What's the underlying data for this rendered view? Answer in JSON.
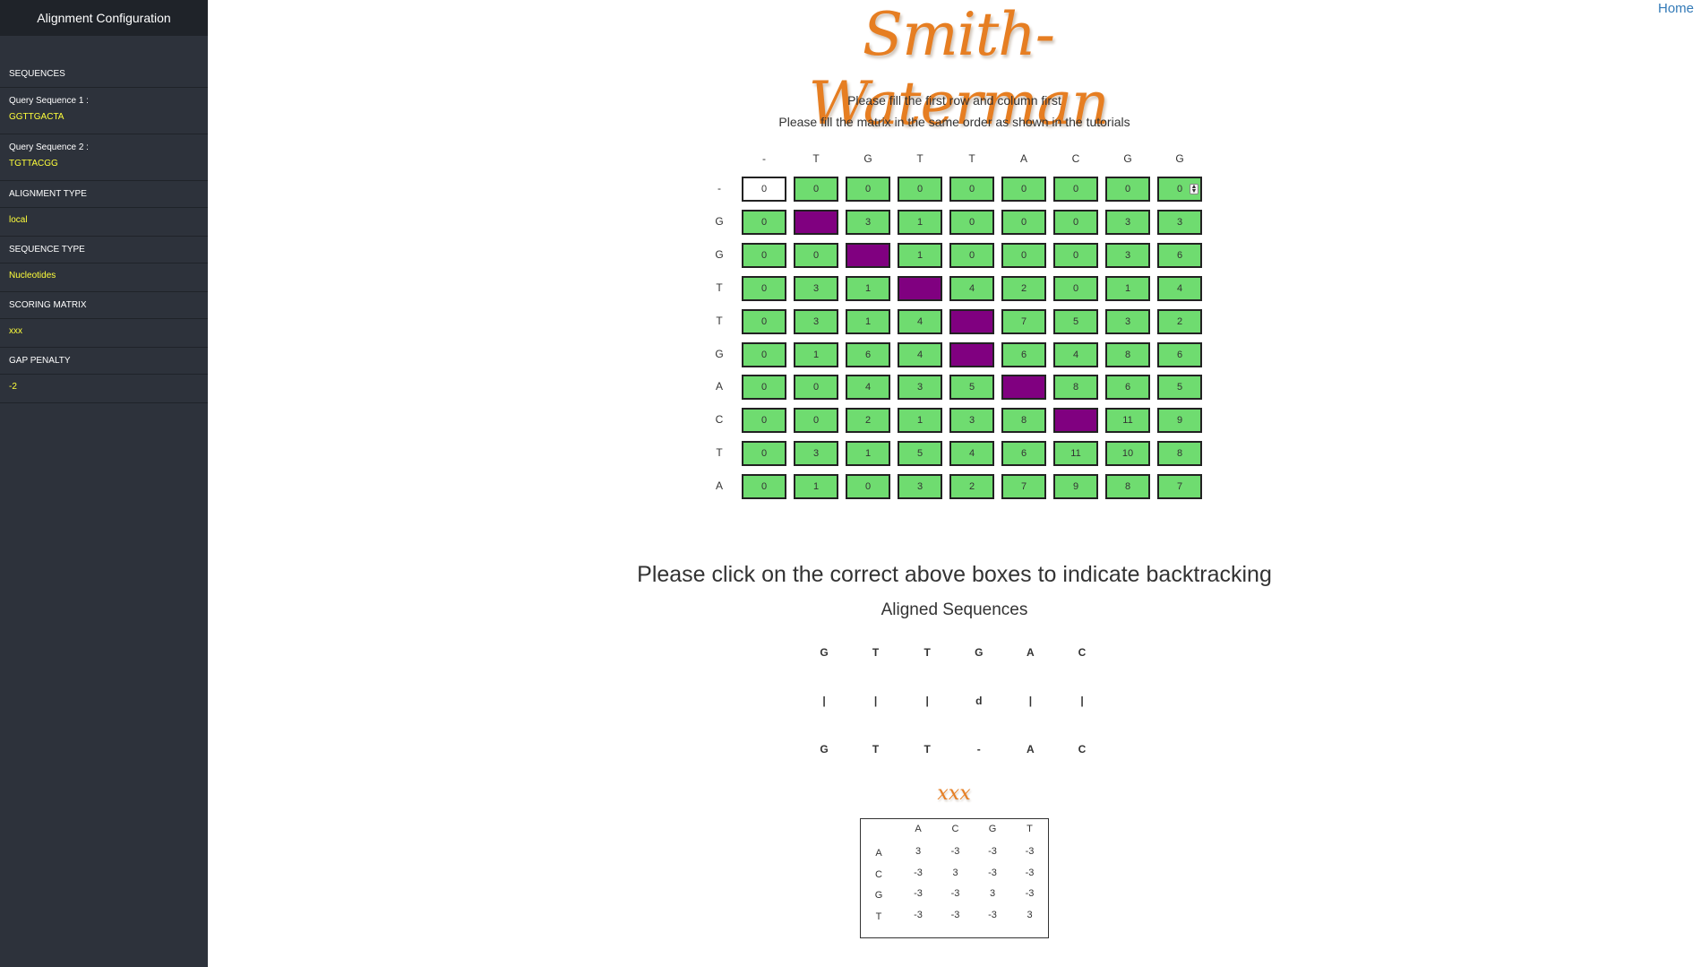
{
  "sidebar": {
    "title": "Alignment Configuration",
    "sequences_heading": "SEQUENCES",
    "query1_label": "Query Sequence 1 :",
    "query1_value": "GGTTGACTA",
    "query2_label": "Query Sequence 2 :",
    "query2_value": "TGTTACGG",
    "alignment_type_heading": "ALIGNMENT TYPE",
    "alignment_type_value": "local",
    "sequence_type_heading": "SEQUENCE TYPE",
    "sequence_type_value": "Nucleotides",
    "scoring_matrix_heading": "SCORING MATRIX",
    "scoring_matrix_value": "xxx",
    "gap_penalty_heading": "GAP PENALTY",
    "gap_penalty_value": "-2"
  },
  "nav": {
    "home": "Home"
  },
  "header": {
    "title": "Smith-Waterman"
  },
  "instructions": {
    "line1": "Please fill the first row and column first",
    "line2": "Please fill the matrix in the same order as shown in the tutorials",
    "backtrack": "Please click on the correct above boxes to indicate backtracking"
  },
  "matrix": {
    "col_headers": [
      "-",
      "T",
      "G",
      "T",
      "T",
      "A",
      "C",
      "G",
      "G"
    ],
    "row_headers": [
      "-",
      "G",
      "G",
      "T",
      "T",
      "G",
      "A",
      "C",
      "T",
      "A"
    ],
    "rows": [
      [
        "0",
        "0",
        "0",
        "0",
        "0",
        "0",
        "0",
        "0",
        "0"
      ],
      [
        "0",
        "",
        "3",
        "1",
        "0",
        "0",
        "0",
        "3",
        "3"
      ],
      [
        "0",
        "0",
        "",
        "1",
        "0",
        "0",
        "0",
        "3",
        "6"
      ],
      [
        "0",
        "3",
        "1",
        "",
        "4",
        "2",
        "0",
        "1",
        "4"
      ],
      [
        "0",
        "3",
        "1",
        "4",
        "",
        "7",
        "5",
        "3",
        "2"
      ],
      [
        "0",
        "1",
        "6",
        "4",
        "",
        "6",
        "4",
        "8",
        "6"
      ],
      [
        "0",
        "0",
        "4",
        "3",
        "5",
        "",
        "8",
        "6",
        "5"
      ],
      [
        "0",
        "0",
        "2",
        "1",
        "3",
        "8",
        "",
        "11",
        "9"
      ],
      [
        "0",
        "3",
        "1",
        "5",
        "4",
        "6",
        "11",
        "10",
        "8"
      ],
      [
        "0",
        "1",
        "0",
        "3",
        "2",
        "7",
        "9",
        "8",
        "7"
      ]
    ],
    "path_cells": [
      [
        1,
        1
      ],
      [
        2,
        2
      ],
      [
        3,
        3
      ],
      [
        4,
        4
      ],
      [
        5,
        4
      ],
      [
        6,
        5
      ],
      [
        7,
        6
      ]
    ],
    "path_color": "#800080",
    "cell_color": "#6fdc70"
  },
  "aligned": {
    "title": "Aligned Sequences",
    "top": [
      "G",
      "T",
      "T",
      "G",
      "A",
      "C"
    ],
    "middle": [
      "|",
      "|",
      "|",
      "d",
      "|",
      "|"
    ],
    "bottom": [
      "G",
      "T",
      "T",
      "-",
      "A",
      "C"
    ]
  },
  "scoring": {
    "name": "xxx",
    "headers": [
      "A",
      "C",
      "G",
      "T"
    ],
    "rows": [
      [
        "3",
        "-3",
        "-3",
        "-3"
      ],
      [
        "-3",
        "3",
        "-3",
        "-3"
      ],
      [
        "-3",
        "-3",
        "3",
        "-3"
      ],
      [
        "-3",
        "-3",
        "-3",
        "3"
      ]
    ]
  }
}
